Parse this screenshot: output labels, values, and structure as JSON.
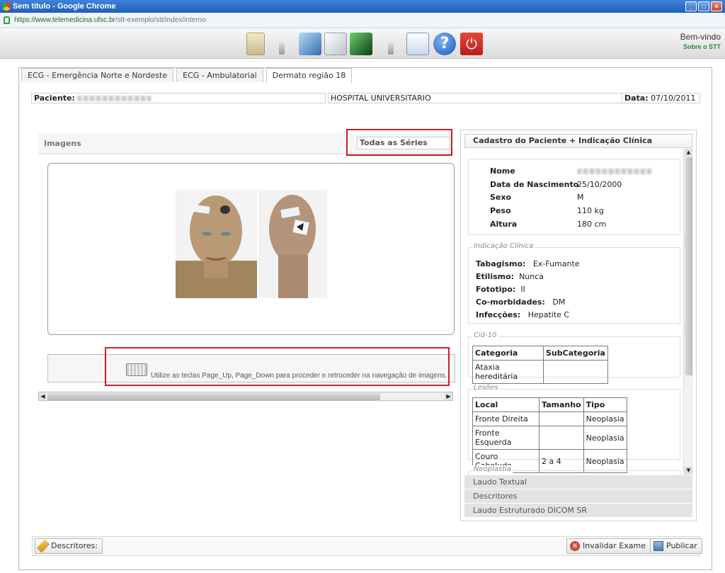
{
  "window": {
    "title": "Sem título - Google Chrome",
    "url_host": "https://www.telemedicina.ufsc.br",
    "url_path": "/stt-exemplo/stt/index/interno"
  },
  "toolbar": {
    "welcome": "Bem-vindo",
    "about": "Sobre o STT",
    "icons": [
      "clipboard-icon",
      "hand-icon",
      "document-pen-icon",
      "body-scan-icon",
      "user-form-icon",
      "help-icon",
      "power-icon"
    ]
  },
  "tabs": [
    "ECG - Emergência Norte e Nordeste",
    "ECG - Ambulatorial",
    "Dermato região 18"
  ],
  "patient_bar": {
    "paciente_label": "Paciente:",
    "hospital": "HOSPITAL UNIVERSITARIO",
    "data_label": "Data:",
    "data_value": "07/10/2011"
  },
  "images": {
    "title": "Imagens",
    "series": "Todas as Séries",
    "help": "Utilize as teclas Page_Up, Page_Down para proceder e retroceder na navegação de imagens."
  },
  "right_panel": {
    "title": "Cadastro do Paciente + Indicação Clínica",
    "cadastro": [
      {
        "label": "Nome",
        "value": ""
      },
      {
        "label": "Data de Nascimento",
        "value": "25/10/2000"
      },
      {
        "label": "Sexo",
        "value": "M"
      },
      {
        "label": "Peso",
        "value": "110 kg"
      },
      {
        "label": "Altura",
        "value": "180 cm"
      }
    ],
    "indicacao": {
      "legend": "Indicação Clínica",
      "items": [
        {
          "label": "Tabagismo:",
          "value": "Ex-Fumante"
        },
        {
          "label": "Etilismo:",
          "value": "Nunca"
        },
        {
          "label": "Fototipo:",
          "value": "II"
        },
        {
          "label": "Co-morbidades:",
          "value": "DM"
        },
        {
          "label": "Infecções:",
          "value": "Hepatite C"
        }
      ]
    },
    "cid": {
      "legend": "Cid-10",
      "headers": [
        "Categoria",
        "SubCategoria"
      ],
      "rows": [
        [
          "Ataxia hereditária",
          ""
        ]
      ]
    },
    "lesoes": {
      "legend": "Lesões",
      "headers": [
        "Local",
        "Tamanho",
        "Tipo"
      ],
      "rows": [
        [
          "Fronte Direita",
          "",
          "Neoplasia"
        ],
        [
          "Fronte Esquerda",
          "",
          "Neoplasia"
        ],
        [
          "Couro Cabeludo",
          "2 a 4",
          "Neoplasia"
        ]
      ]
    },
    "neoplastia_legend": "Neoplastia",
    "accordion": [
      "Laudo Textual",
      "Descritores",
      "Laudo Estruturado DICOM SR"
    ]
  },
  "bottom": {
    "descritores": "Descritores:",
    "invalidar": "Invalidar Exame",
    "publicar": "Publicar"
  }
}
